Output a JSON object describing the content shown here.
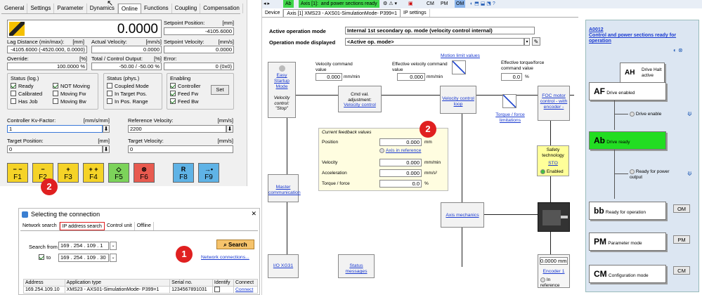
{
  "left_panel": {
    "tabs": [
      "General",
      "Settings",
      "Parameter",
      "Dynamics",
      "Online",
      "Functions",
      "Coupling",
      "Compensation"
    ],
    "active_tab": "Online",
    "big_value": "0.0000",
    "setpoint_position": {
      "label": "Setpoint Position:",
      "unit": "[mm]",
      "value": "-4105.6000"
    },
    "lag_distance": {
      "label": "Lag Distance (min/max):",
      "unit": "[mm]",
      "value": "-4105.6000 (-4520.000, 0.0000)"
    },
    "actual_velocity": {
      "label": "Actual Velocity:",
      "unit": "[mm/s]",
      "value": "0.0000"
    },
    "setpoint_velocity": {
      "label": "Setpoint Velocity:",
      "unit": "[mm/s]",
      "value": "0.0000"
    },
    "override": {
      "label": "Override:",
      "unit": "[%]",
      "value": "100.0000 %"
    },
    "total_control_output": {
      "label": "Total / Control Output:",
      "unit": "[%]",
      "value": "-50.00 / -50.00 %"
    },
    "error": {
      "label": "Error:",
      "value": "0 (0x0)"
    },
    "status_log": {
      "title": "Status (log.)",
      "items": [
        {
          "label": "Ready",
          "checked": true
        },
        {
          "label": "NOT Moving",
          "checked": true
        },
        {
          "label": "Calibrated",
          "checked": false
        },
        {
          "label": "Moving Fw",
          "checked": false
        },
        {
          "label": "Has Job",
          "checked": false
        },
        {
          "label": "Moving Bw",
          "checked": false
        }
      ]
    },
    "status_phys": {
      "title": "Status (phys.)",
      "items": [
        {
          "label": "Coupled Mode",
          "checked": false
        },
        {
          "label": "In Target Pos.",
          "checked": false
        },
        {
          "label": "In Pos. Range",
          "checked": false
        }
      ]
    },
    "enabling": {
      "title": "Enabling",
      "items": [
        {
          "label": "Controller",
          "checked": true
        },
        {
          "label": "Feed Fw",
          "checked": true
        },
        {
          "label": "Feed Bw",
          "checked": true
        }
      ],
      "set_label": "Set"
    },
    "kv_factor": {
      "label": "Controller Kv-Factor:",
      "unit": "[mm/s/mm]",
      "value": "1"
    },
    "reference_velocity": {
      "label": "Reference Velocity:",
      "unit": "[mm/s]",
      "value": "2200"
    },
    "target_position": {
      "label": "Target Position:",
      "unit": "[mm]",
      "value": "0"
    },
    "target_velocity": {
      "label": "Target Velocity:",
      "unit": "[mm/s]",
      "value": "0"
    },
    "fkeys": [
      {
        "sym": "− −",
        "key": "F1",
        "color": "yellow"
      },
      {
        "sym": "−",
        "key": "F2",
        "color": "yellow"
      },
      {
        "sym": "+",
        "key": "F3",
        "color": "yellow"
      },
      {
        "sym": "+ +",
        "key": "F4",
        "color": "yellow"
      },
      {
        "sym": "◇",
        "key": "F5",
        "color": "green"
      },
      {
        "sym": "⊗",
        "key": "F6",
        "color": "red"
      },
      {
        "sym": "R",
        "key": "F8",
        "color": "blue"
      },
      {
        "sym": "→•",
        "key": "F9",
        "color": "blue"
      }
    ]
  },
  "connection_dialog": {
    "title": "Selecting the connection",
    "close": "✕",
    "tabs": [
      "Network search",
      "IP address search",
      "Control unit",
      "Offline"
    ],
    "active_tab": "IP address search",
    "search_from_label": "Search from",
    "from_ip": [
      "169",
      "254",
      "109",
      "1"
    ],
    "to_label": "to",
    "to_ip": [
      "169",
      "254",
      "109",
      "30"
    ],
    "search_button": "Search",
    "network_connections_link": "Network connections...",
    "table_headers": [
      "Address",
      "Application type",
      "Serial no.",
      "Identify",
      "Connect"
    ],
    "rows": [
      [
        "169.254.109.10",
        "XMS23 - AXS01-SimulationMode- P399=1",
        "1234567891031",
        "",
        "Connect"
      ]
    ]
  },
  "badges": {
    "one": "1",
    "two": "2"
  },
  "right_panel": {
    "toolbar": {
      "ab": "Ab",
      "axis_state": "Axis [1]:",
      "ready_text": "and power sections ready",
      "cm": "CM",
      "pm": "PM",
      "om": "OM"
    },
    "tabs": [
      "Device",
      "Axis [1] XMS23 - AXS01-SimulationMode- P399=1",
      "IP settings"
    ],
    "active_mode_label": "Active operation mode",
    "active_mode_value": "Internal 1st secondary op. mode (velocity control internal)",
    "displayed_mode_label": "Operation mode displayed",
    "displayed_mode_value": "<Active op. mode>",
    "easy_startup": "Easy Startup Mode",
    "velocity_control_stop": "Velocity control: \"Stop\"",
    "vel_cmd_label": "Velocity command value",
    "vel_cmd_value": "0.000",
    "vel_cmd_unit": "mm/min",
    "eff_vel_cmd_label": "Effective velocity command value",
    "eff_vel_cmd_value": "0.000",
    "eff_vel_cmd_unit": "mm/min",
    "motion_limit": "Motion limit values",
    "eff_torque_label": "Effective torque/force command value",
    "eff_torque_value": "0.0",
    "eff_torque_unit": "%",
    "cmd_adjust": "Cmd val. adjustment:",
    "velocity_control": "Velocity control",
    "velocity_control_loop": "Velocity control loop",
    "torque_force_limitations": "Torque / force limitations",
    "foc": "FOC motor control - with encoder -",
    "feedback": {
      "title": "Current feedback values",
      "position_label": "Position",
      "position_value": "0.000",
      "position_unit": "mm",
      "axis_ref": "Axis in reference",
      "velocity_label": "Velocity",
      "velocity_value": "0.000",
      "velocity_unit": "mm/min",
      "accel_label": "Acceleration",
      "accel_value": "0.000",
      "accel_unit": "mm/s²",
      "torque_label": "Torque / force",
      "torque_value": "0.0",
      "torque_unit": "%"
    },
    "safety": {
      "title": "Safety technology",
      "sto": "STO",
      "enabled": "Enabled"
    },
    "master_communication": "Master communication",
    "axis_mechanics": "Axis mechanics",
    "io_xg31": "I/O XG31",
    "status_messages": "Status messages",
    "encoder_value": "0.0000",
    "encoder_unit": "mm",
    "encoder_label": "Encoder 1",
    "in_reference": "In reference"
  },
  "state_machine": {
    "title_code": "A0012",
    "title_text": "Control and power sections ready for operation",
    "ah": {
      "code": "AH",
      "text": "Drive Halt active"
    },
    "af": {
      "code": "AF",
      "text": "Drive enabled"
    },
    "drive_enable": "Drive enable",
    "ab": {
      "code": "Ab",
      "text": "Drive ready"
    },
    "ready_power": "Ready for power output",
    "bb": {
      "code": "bb",
      "text": "Ready for operation",
      "btn": "OM"
    },
    "pm": {
      "code": "PM",
      "text": "Parameter mode",
      "btn": "PM"
    },
    "cm": {
      "code": "CM",
      "text": "Configuration mode",
      "btn": "CM"
    }
  },
  "colors": {
    "yellow": "#f5d327",
    "green": "#7cd35a",
    "red": "#e85a4f",
    "blue": "#5fb3e6",
    "drive_ready": "#22dd22",
    "feedback_bg": "#fffde0",
    "safety_bg": "#ffff99",
    "state_panel_bg": "#dce6f2"
  }
}
